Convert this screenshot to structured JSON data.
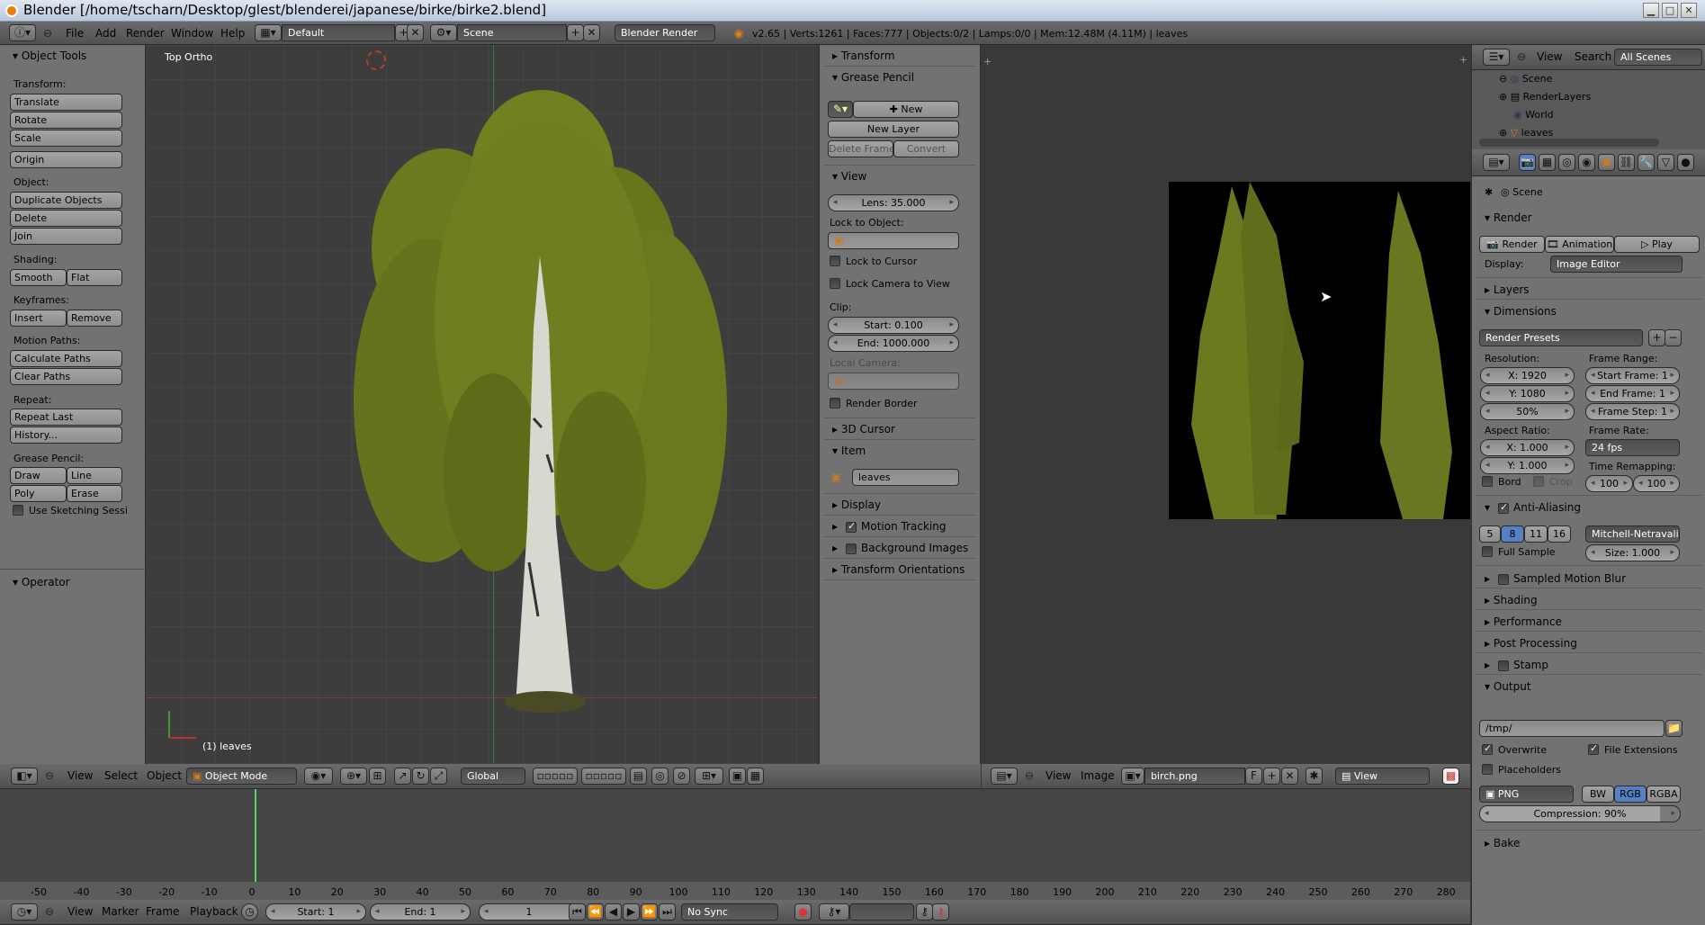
{
  "window": {
    "title": "Blender [/home/tscharn/Desktop/glest/blenderei/japanese/birke/birke2.blend]"
  },
  "info_bar": {
    "menus": [
      "File",
      "Add",
      "Render",
      "Window",
      "Help"
    ],
    "layout": "Default",
    "scene": "Scene",
    "engine": "Blender Render",
    "stats": "v2.65 | Verts:1261 | Faces:777 | Objects:0/2 | Lamps:0/0 | Mem:12.48M (4.11M) | leaves"
  },
  "tool_shelf": {
    "title": "Object Tools",
    "transform_label": "Transform:",
    "translate": "Translate",
    "rotate": "Rotate",
    "scale": "Scale",
    "origin": "Origin",
    "object_label": "Object:",
    "duplicate": "Duplicate Objects",
    "delete": "Delete",
    "join": "Join",
    "shading_label": "Shading:",
    "smooth": "Smooth",
    "flat": "Flat",
    "keyframes_label": "Keyframes:",
    "insert": "Insert",
    "remove": "Remove",
    "motion_label": "Motion Paths:",
    "calc_paths": "Calculate Paths",
    "clear_paths": "Clear Paths",
    "repeat_label": "Repeat:",
    "repeat_last": "Repeat Last",
    "history": "History...",
    "gp_label": "Grease Pencil:",
    "draw": "Draw",
    "line": "Line",
    "poly": "Poly",
    "erase": "Erase",
    "sketching": "Use Sketching Sessi",
    "operator": "Operator"
  },
  "viewport": {
    "view_name": "Top Ortho",
    "object_label": "(1) leaves"
  },
  "properties_region": {
    "transform": "Transform",
    "grease_pencil": "Grease Pencil",
    "new": "New",
    "new_layer": "New Layer",
    "delete_frame": "Delete Frame",
    "convert": "Convert",
    "view": "View",
    "lens": "Lens: 35.000",
    "lock_to_object": "Lock to Object:",
    "lock_to_cursor": "Lock to Cursor",
    "lock_camera": "Lock Camera to View",
    "clip": "Clip:",
    "clip_start": "Start: 0.100",
    "clip_end": "End: 1000.000",
    "local_camera": "Local Camera:",
    "render_border": "Render Border",
    "cursor_3d": "3D Cursor",
    "item": "Item",
    "item_name": "leaves",
    "display": "Display",
    "motion_tracking": "Motion Tracking",
    "background_images": "Background Images",
    "transform_orientations": "Transform Orientations"
  },
  "view3d_header": {
    "menus": [
      "View",
      "Select",
      "Object"
    ],
    "mode": "Object Mode",
    "orientation": "Global"
  },
  "image_editor_header": {
    "menus": [
      "View",
      "Image"
    ],
    "image": "birch.png",
    "fake": "F",
    "view": "View"
  },
  "timeline": {
    "ticks": [
      "-50",
      "-40",
      "-30",
      "-20",
      "-10",
      "0",
      "10",
      "20",
      "30",
      "40",
      "50",
      "60",
      "70",
      "80",
      "90",
      "100",
      "110",
      "120",
      "130",
      "140",
      "150",
      "160",
      "170",
      "180",
      "190",
      "200",
      "210",
      "220",
      "230",
      "240",
      "250",
      "260",
      "270",
      "280"
    ],
    "menus": [
      "View",
      "Marker",
      "Frame",
      "Playback"
    ],
    "start": "Start: 1",
    "end": "End: 1",
    "current": "1",
    "sync": "No Sync"
  },
  "outliner": {
    "menus": [
      "View",
      "Search"
    ],
    "filter": "All Scenes",
    "items": [
      "Scene",
      "RenderLayers",
      "World",
      "leaves"
    ]
  },
  "render_props": {
    "context": "Scene",
    "render": "Render",
    "render_btn": "Render",
    "animation_btn": "Animation",
    "play_btn": "Play",
    "display_label": "Display:",
    "display_value": "Image Editor",
    "layers": "Layers",
    "dimensions": "Dimensions",
    "presets": "Render Presets",
    "resolution": "Resolution:",
    "res_x": "X: 1920",
    "res_y": "Y: 1080",
    "res_pct": "50%",
    "frame_range": "Frame Range:",
    "start_frame": "Start Frame: 1",
    "end_frame": "End Frame: 1",
    "frame_step": "Frame Step: 1",
    "aspect": "Aspect Ratio:",
    "asp_x": "X: 1.000",
    "asp_y": "Y: 1.000",
    "frame_rate": "Frame Rate:",
    "fps": "24 fps",
    "time_remap": "Time Remapping:",
    "remap_old": "100",
    "remap_new": "100",
    "bord": "Bord",
    "crop": "Crop",
    "anti_aliasing": "Anti-Aliasing",
    "aa_samples": [
      "5",
      "8",
      "11",
      "16"
    ],
    "aa_filter": "Mitchell-Netravali",
    "full_sample": "Full Sample",
    "aa_size": "Size: 1.000",
    "motion_blur": "Sampled Motion Blur",
    "shading": "Shading",
    "performance": "Performance",
    "post_processing": "Post Processing",
    "stamp": "Stamp",
    "output": "Output",
    "output_path": "/tmp/",
    "overwrite": "Overwrite",
    "file_ext": "File Extensions",
    "placeholders": "Placeholders",
    "format": "PNG",
    "bw": "BW",
    "rgb": "RGB",
    "rgba": "RGBA",
    "compression": "Compression: 90%",
    "bake": "Bake"
  },
  "colors": {
    "accent": "#5680c2",
    "foliage": "#6b7a1f",
    "bark": "#e3e3dc"
  }
}
